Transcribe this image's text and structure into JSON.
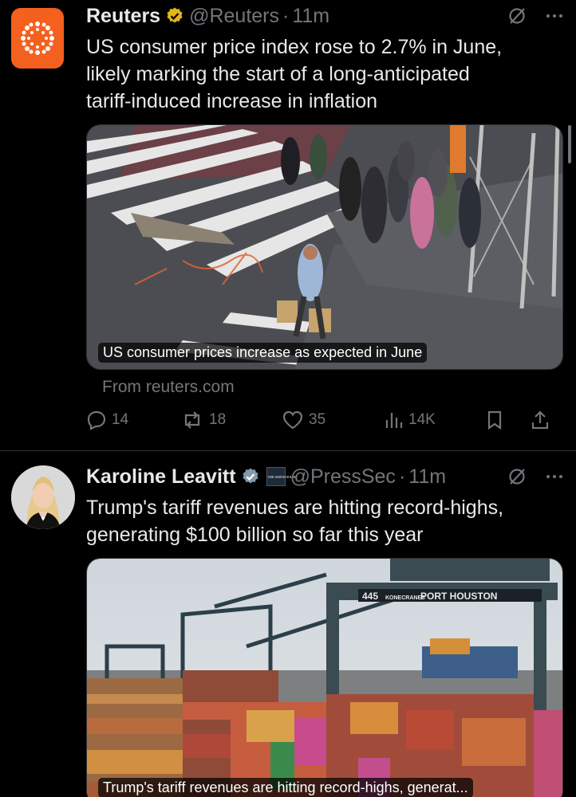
{
  "tweets": [
    {
      "author": "Reuters",
      "handle": "@Reuters",
      "time": "11m",
      "text_lines": [
        "US consumer price index rose to 2.7% in June,",
        "likely marking the start of a long-anticipated",
        "tariff-induced increase in inflation"
      ],
      "media_caption": "US consumer prices increase as expected in June",
      "source": "From reuters.com",
      "replies": "14",
      "reposts": "18",
      "likes": "35",
      "views": "14K"
    },
    {
      "author": "Karoline Leavitt",
      "handle": "@PressSec",
      "time": "11m",
      "affiliation_badge": "THE WHITE HOUSE",
      "text_lines": [
        "Trump's tariff revenues are hitting record-highs,",
        "generating $100 billion so far this year"
      ],
      "media_caption": "Trump's tariff revenues are hitting record-highs, generat...",
      "crane_sign": {
        "number": "445",
        "brand": "KONECRANES",
        "name": "PORT HOUSTON"
      }
    }
  ],
  "colors": {
    "background": "#000000",
    "text": "#e7e9ea",
    "secondary": "#71767b",
    "verified_gold": "#e2b719",
    "verified_gray": "#829aab",
    "reuters_orange": "#f4601d"
  },
  "separator": "·"
}
